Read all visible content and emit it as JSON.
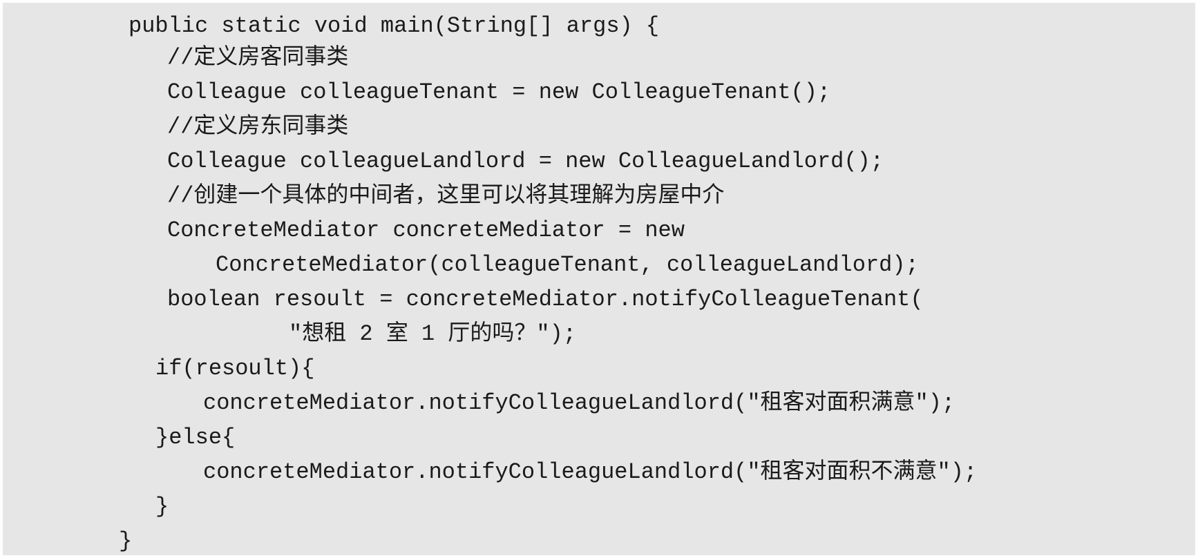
{
  "code": {
    "lines": [
      "public static void main(String[] args) {",
      "//定义房客同事类",
      "Colleague colleagueTenant = new ColleagueTenant();",
      "//定义房东同事类",
      "Colleague colleagueLandlord = new ColleagueLandlord();",
      "//创建一个具体的中间者，这里可以将其理解为房屋中介",
      "ConcreteMediator concreteMediator = new",
      "ConcreteMediator(colleagueTenant, colleagueLandlord);",
      "boolean resoult = concreteMediator.notifyColleagueTenant(",
      "\"想租 2 室 1 厅的吗？\");",
      "if(resoult){",
      "concreteMediator.notifyColleagueLandlord(\"租客对面积满意\");",
      "}else{",
      "concreteMediator.notifyColleagueLandlord(\"租客对面积不满意\");",
      "}",
      "}"
    ]
  }
}
